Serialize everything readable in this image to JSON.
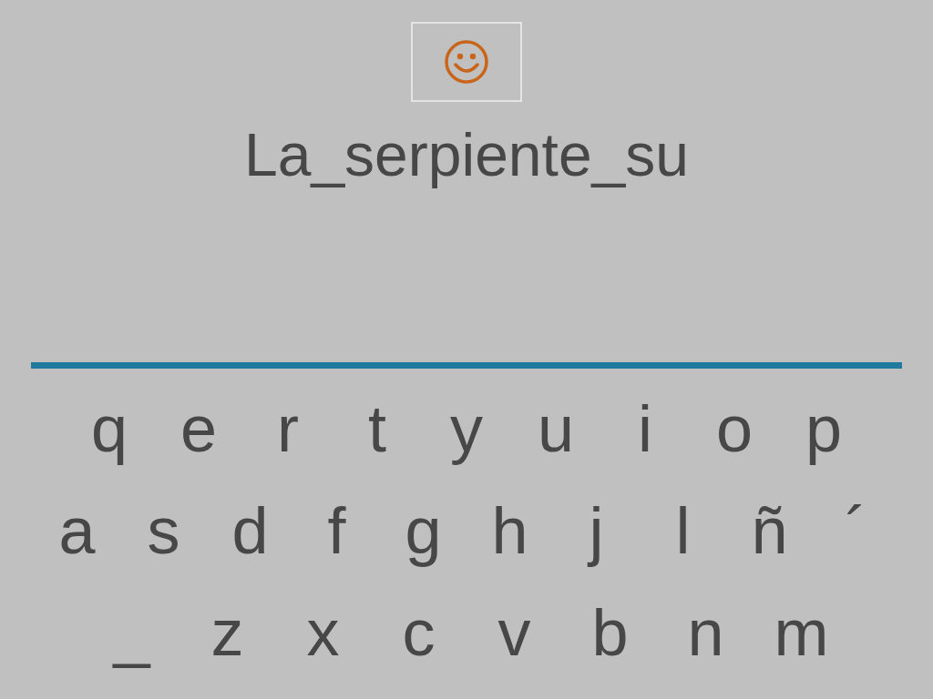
{
  "phrase": "La_serpiente_su",
  "keyboard": {
    "rows": [
      [
        "q",
        "e",
        "r",
        "t",
        "y",
        "u",
        "i",
        "o",
        "p"
      ],
      [
        "a",
        "s",
        "d",
        "f",
        "g",
        "h",
        "j",
        "l",
        "ñ",
        "´"
      ],
      [
        "_",
        "z",
        "x",
        "c",
        "v",
        "b",
        "n",
        "m"
      ]
    ]
  }
}
